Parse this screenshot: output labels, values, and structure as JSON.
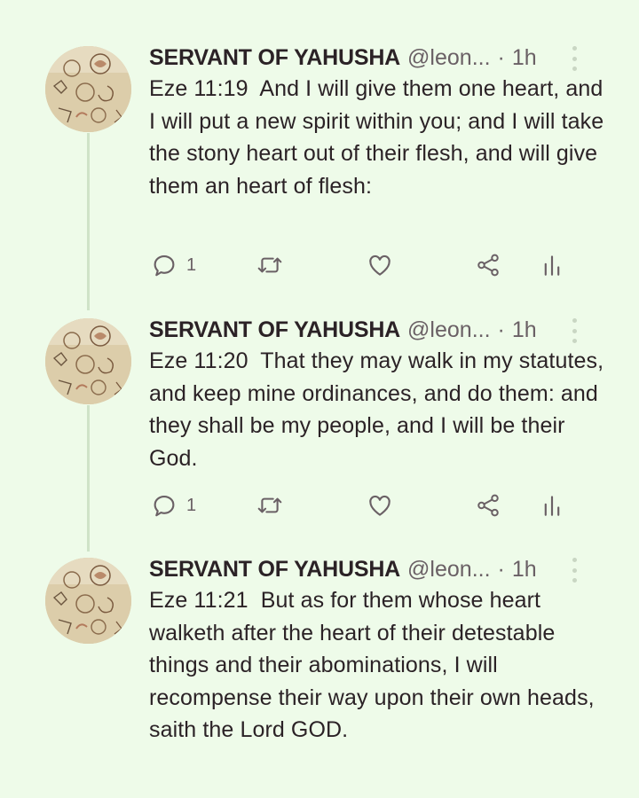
{
  "theme": {
    "background": "#eefbe9",
    "text": "#2b2226",
    "muted": "#6a6065",
    "thread_line": "#cfe3c8"
  },
  "tweets": [
    {
      "author_name": "SERVANT OF YAHUSHA",
      "handle": "@leon...",
      "separator": "·",
      "time": "1h",
      "text": "Eze 11:19  And I will give them one heart, and I will put a new spirit within you; and I will take the stony heart out of their flesh, and will give them an heart of flesh:",
      "reply_count": "1",
      "icons": [
        "reply-icon",
        "retweet-icon",
        "like-icon",
        "share-icon",
        "analytics-icon"
      ]
    },
    {
      "author_name": "SERVANT OF YAHUSHA",
      "handle": "@leon...",
      "separator": "·",
      "time": "1h",
      "text": "Eze 11:20  That they may walk in my statutes, and keep mine ordinances, and do them: and they shall be my people, and I will be their God.",
      "reply_count": "1",
      "icons": [
        "reply-icon",
        "retweet-icon",
        "like-icon",
        "share-icon",
        "analytics-icon"
      ]
    },
    {
      "author_name": "SERVANT OF YAHUSHA",
      "handle": "@leon...",
      "separator": "·",
      "time": "1h",
      "text": "Eze 11:21  But as for them whose heart walketh after the heart of their detestable things and their abominations, I will recompense their way upon their own heads, saith the Lord GOD."
    }
  ]
}
